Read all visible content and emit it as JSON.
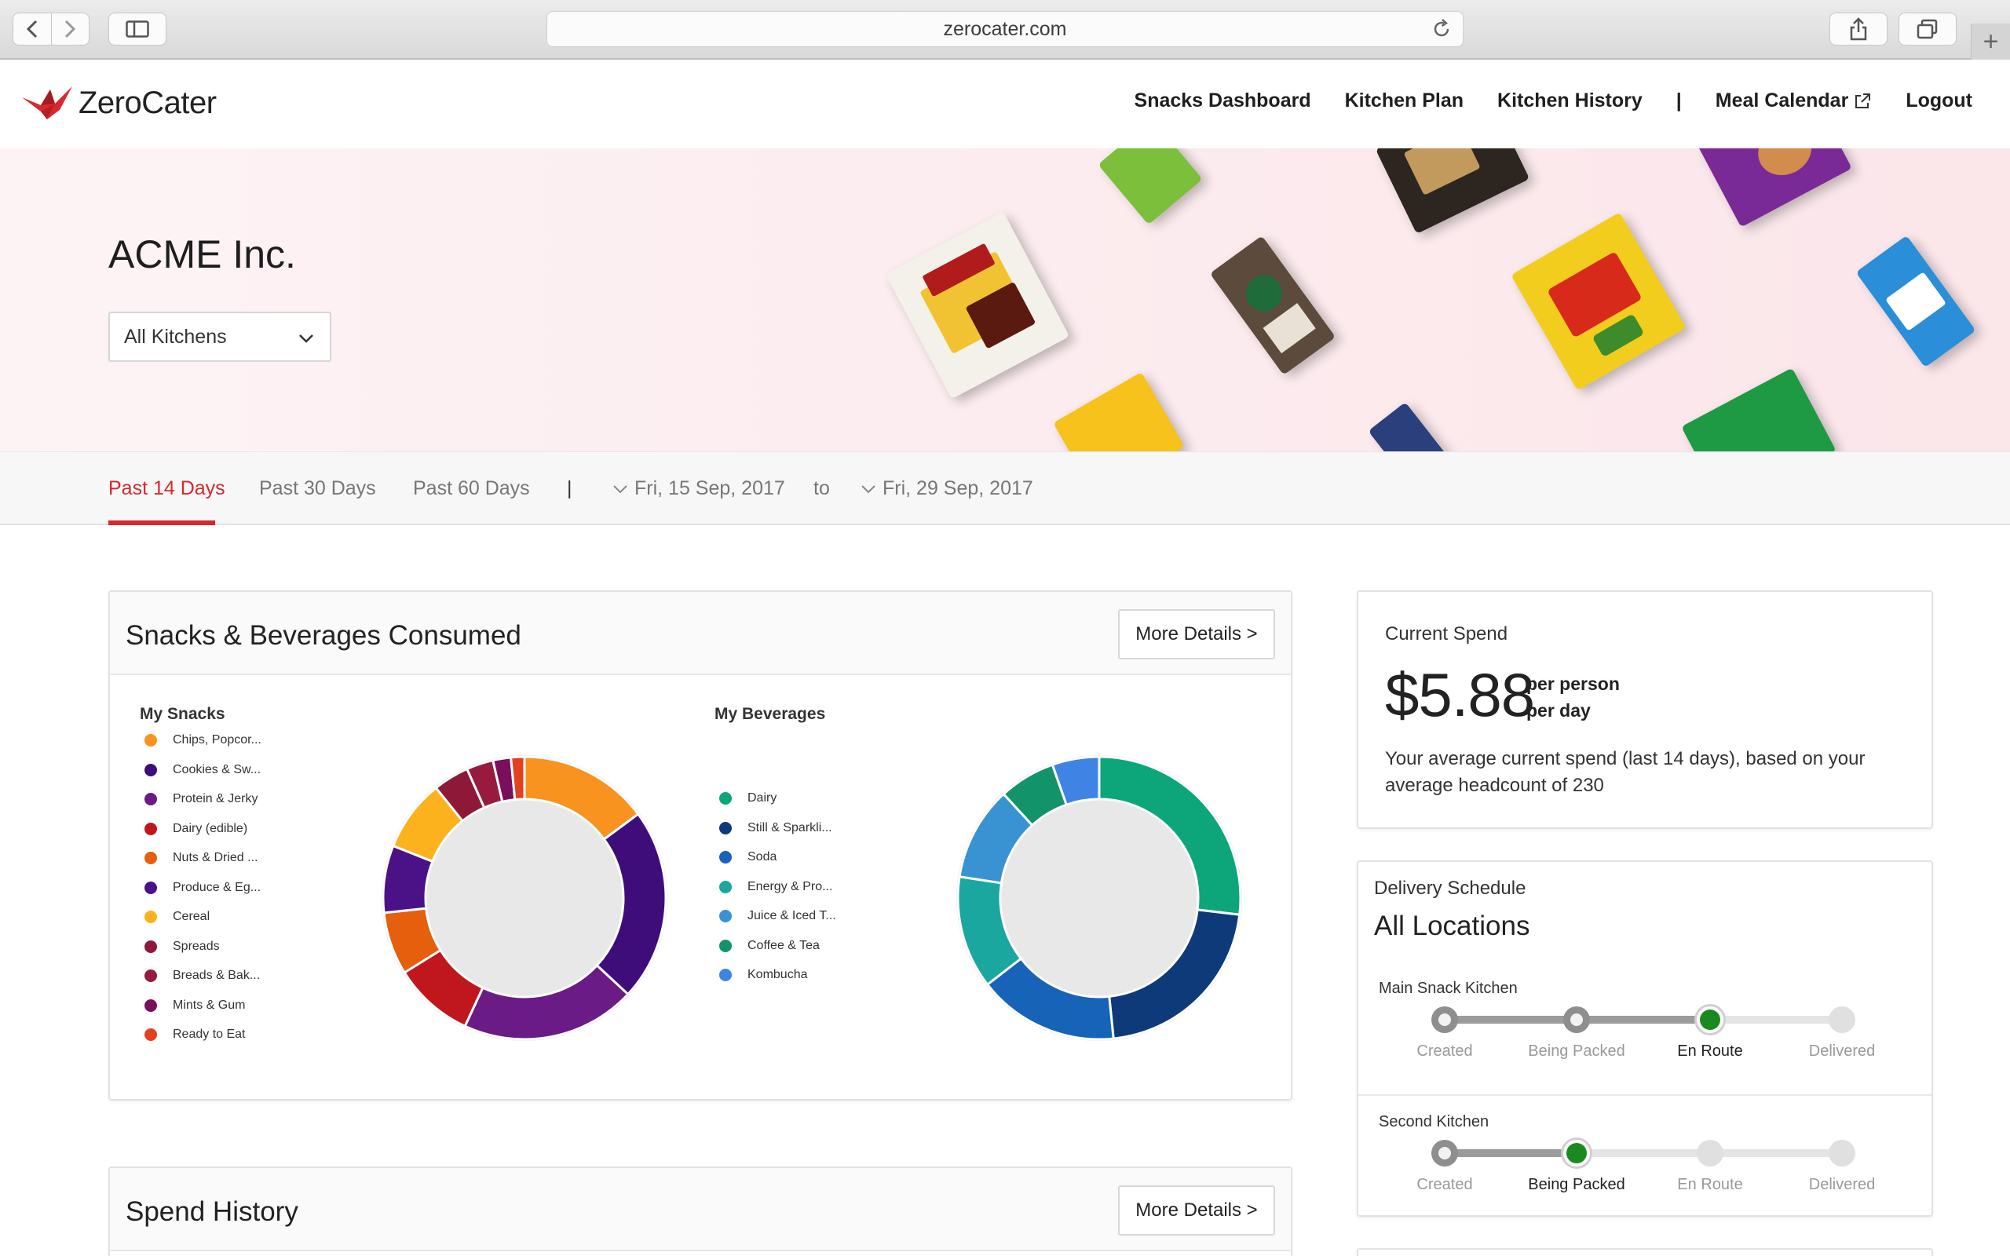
{
  "browser": {
    "url": "zerocater.com"
  },
  "brand": {
    "name": "ZeroCater",
    "accent": "#d9272e"
  },
  "nav": {
    "items": [
      "Snacks Dashboard",
      "Kitchen Plan",
      "Kitchen History"
    ],
    "separator": "|",
    "meal_calendar": "Meal Calendar",
    "logout": "Logout"
  },
  "hero": {
    "company": "ACME Inc.",
    "kitchen_select": "All Kitchens"
  },
  "filters": {
    "ranges": [
      "Past 14 Days",
      "Past 30 Days",
      "Past 60 Days"
    ],
    "active": "Past 14 Days",
    "separator": "|",
    "start_date": "Fri, 15 Sep, 2017",
    "to": "to",
    "end_date": "Fri, 29 Sep, 2017"
  },
  "consumption": {
    "title": "Snacks & Beverages Consumed",
    "more_details": "More Details >",
    "snacks_title": "My Snacks",
    "beverages_title": "My Beverages"
  },
  "chart_data": [
    {
      "type": "pie",
      "title": "My Snacks",
      "donut": true,
      "categories": [
        "Chips, Popcor...",
        "Cookies & Sw...",
        "Protein & Jerky",
        "Dairy (edible)",
        "Nuts & Dried ...",
        "Produce & Eg...",
        "Cereal",
        "Spreads",
        "Breads & Bak...",
        "Mints & Gum",
        "Ready to Eat"
      ],
      "values": [
        14.5,
        21.5,
        19.5,
        9,
        7,
        7.5,
        8,
        4,
        3,
        2,
        1.5
      ],
      "colors": [
        "#f7931e",
        "#3f0d7a",
        "#6a1b86",
        "#c0161d",
        "#e55f0c",
        "#4b1186",
        "#fbb21c",
        "#8e1838",
        "#961b3f",
        "#7c0f5c",
        "#e3401f"
      ]
    },
    {
      "type": "pie",
      "title": "My Beverages",
      "donut": true,
      "categories": [
        "Dairy",
        "Still & Sparkli...",
        "Soda",
        "Energy & Pro...",
        "Juice & Iced T...",
        "Coffee & Tea",
        "Kombucha"
      ],
      "values": [
        25,
        20,
        15,
        12,
        10,
        6,
        5
      ],
      "colors": [
        "#0da57a",
        "#0e3a7a",
        "#1763b8",
        "#1aa7a0",
        "#3993d3",
        "#13936a",
        "#3f84e4"
      ]
    }
  ],
  "spend": {
    "label": "Current Spend",
    "value": "$5.88",
    "unit_line1": "per person",
    "unit_line2": "per day",
    "description": "Your average current spend (last 14 days), based on your average headcount of 230"
  },
  "delivery": {
    "label": "Delivery Schedule",
    "title": "All Locations",
    "steps": [
      "Created",
      "Being Packed",
      "En Route",
      "Delivered"
    ],
    "kitchens": [
      {
        "name": "Main Snack Kitchen",
        "current_step": 2
      },
      {
        "name": "Second Kitchen",
        "current_step": 1
      }
    ]
  },
  "spend_history": {
    "title": "Spend History",
    "more_details": "More Details >"
  }
}
